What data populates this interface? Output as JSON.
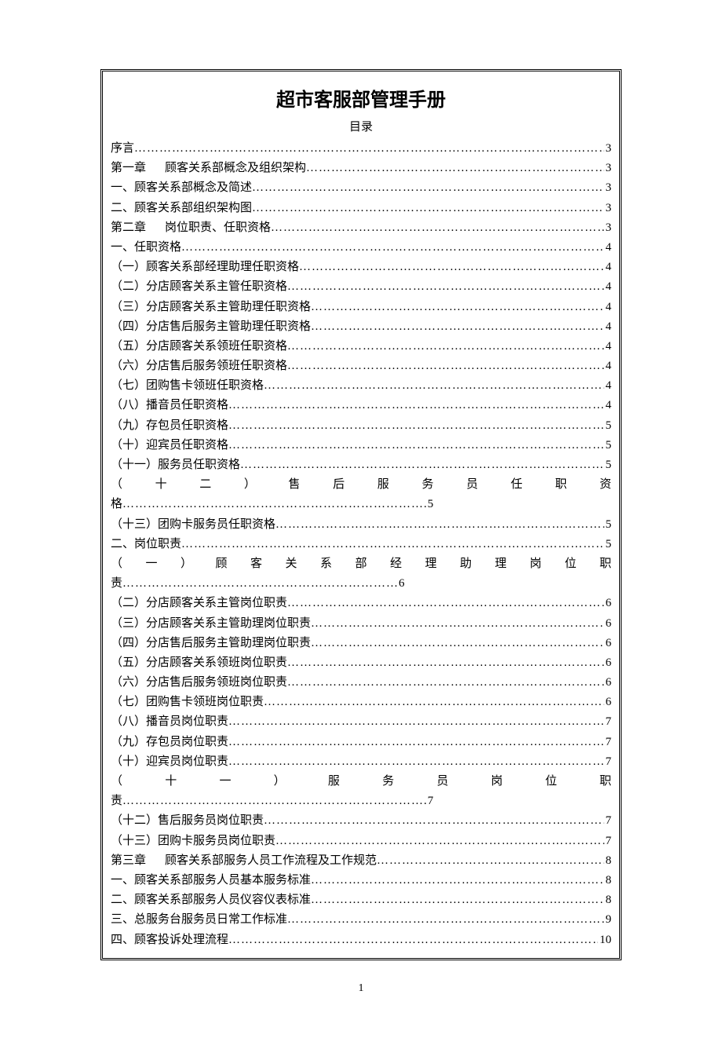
{
  "title": "超市客服部管理手册",
  "subtitle": "目录",
  "page_number": "1",
  "toc": [
    {
      "type": "simple",
      "label": "序言",
      "page": "3"
    },
    {
      "type": "chapter",
      "prefix": "第一章",
      "label": "顾客关系部概念及组织架构",
      "page": "3"
    },
    {
      "type": "simple",
      "label": "一、顾客关系部概念及简述",
      "page": "3"
    },
    {
      "type": "simple",
      "label": "二、顾客关系部组织架构图",
      "page": "3"
    },
    {
      "type": "chapter",
      "prefix": "第二章",
      "label": "岗位职责、任职资格",
      "page": "3"
    },
    {
      "type": "simple",
      "label": "一、任职资格",
      "page": "4"
    },
    {
      "type": "simple",
      "label": "（一）顾客关系部经理助理任职资格",
      "page": "4"
    },
    {
      "type": "simple",
      "label": "（二）分店顾客关系主管任职资格",
      "page": "4"
    },
    {
      "type": "simple",
      "label": "（三）分店顾客关系主管助理任职资格",
      "page": "4"
    },
    {
      "type": "simple",
      "label": "（四）分店售后服务主管助理任职资格",
      "page": "4"
    },
    {
      "type": "simple",
      "label": "（五）分店顾客关系领班任职资格",
      "page": "4"
    },
    {
      "type": "simple",
      "label": "（六）分店售后服务领班任职资格",
      "page": "4"
    },
    {
      "type": "simple",
      "label": "（七）团购售卡领班任职资格",
      "page": "4"
    },
    {
      "type": "simple",
      "label": "（八）播音员任职资格",
      "page": "4"
    },
    {
      "type": "simple",
      "label": "（九）存包员任职资格",
      "page": "5"
    },
    {
      "type": "simple",
      "label": "（十）迎宾员任职资格",
      "page": "5"
    },
    {
      "type": "simple",
      "label": "（十一）服务员任职资格",
      "page": "5"
    },
    {
      "type": "justify",
      "line1": "（十二）售后服务员任职资",
      "line2_label": "格",
      "line2_dots": "……………………………………………………………….",
      "page": "5"
    },
    {
      "type": "simple",
      "label": "（十三）团购卡服务员任职资格",
      "page": "5"
    },
    {
      "type": "simple",
      "label": "二、岗位职责",
      "page": "5"
    },
    {
      "type": "justify",
      "line1": "（一）顾客关系部经理助理岗位职",
      "line2_label": "责",
      "line2_dots": "…………………………………………………………",
      "page": "6"
    },
    {
      "type": "simple",
      "label": "（二）分店顾客关系主管岗位职责",
      "page": "6"
    },
    {
      "type": "simple",
      "label": "（三）分店顾客关系主管助理岗位职责",
      "page": "6"
    },
    {
      "type": "simple",
      "label": "（四）分店售后服务主管助理岗位职责",
      "page": "6"
    },
    {
      "type": "simple",
      "label": "（五）分店顾客关系领班岗位职责",
      "page": "6"
    },
    {
      "type": "simple",
      "label": "（六）分店售后服务领班岗位职责",
      "page": "6"
    },
    {
      "type": "simple",
      "label": "（七）团购售卡领班岗位职责",
      "page": "6"
    },
    {
      "type": "simple",
      "label": "（八）播音员岗位职责",
      "page": "7"
    },
    {
      "type": "simple",
      "label": "（九）存包员岗位职责",
      "page": "7"
    },
    {
      "type": "simple",
      "label": "（十）迎宾员岗位职责",
      "page": "7"
    },
    {
      "type": "justify",
      "line1": "（十一）服务员岗位职",
      "line2_label": "责",
      "line2_dots": "……………………………………………………………….",
      "page": "7"
    },
    {
      "type": "simple",
      "label": "（十二）售后服务员岗位职责",
      "page": "7"
    },
    {
      "type": "simple",
      "label": "（十三）团购卡服务员岗位职责",
      "page": "7"
    },
    {
      "type": "chapter",
      "prefix": "第三章",
      "label": "顾客关系部服务人员工作流程及工作规范",
      "page": "8"
    },
    {
      "type": "simple",
      "label": "一、顾客关系部服务人员基本服务标准",
      "page": "8"
    },
    {
      "type": "simple",
      "label": "二、顾客关系部服务人员仪容仪表标准",
      "page": "8"
    },
    {
      "type": "simple",
      "label": "三、总服务台服务员日常工作标准",
      "page": "9"
    },
    {
      "type": "simple",
      "label": "四、顾客投诉处理流程",
      "page": "10"
    }
  ]
}
